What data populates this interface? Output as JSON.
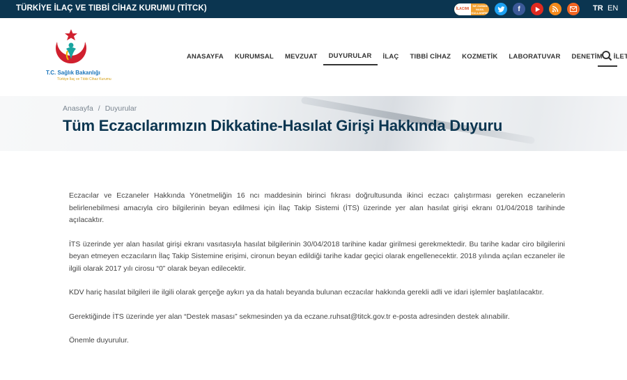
{
  "topbar": {
    "org_name": "TÜRKİYE İLAÇ VE TIBBİ CİHAZ KURUMU (TİTCK)",
    "badge": {
      "left": "İLACIMI",
      "right": "NE ZAMAN NASIL KULLANIRIM"
    },
    "social_icons": [
      "twitter-icon",
      "facebook-icon",
      "youtube-icon",
      "rss-icon",
      "mail-icon"
    ],
    "lang_tr": "TR",
    "lang_en": "EN"
  },
  "logo": {
    "line1": "T.C. Sağlık Bakanlığı",
    "line2": "Türkiye İlaç ve Tıbbi Cihaz Kurumu"
  },
  "nav": {
    "items": [
      "ANASAYFA",
      "KURUMSAL",
      "MEVZUAT",
      "DUYURULAR",
      "İLAÇ",
      "TIBBİ CİHAZ",
      "KOZMETİK",
      "LABORATUVAR",
      "DENETİM",
      "İLETİŞİM"
    ],
    "active": "DUYURULAR"
  },
  "breadcrumb": {
    "home": "Anasayfa",
    "separator": "/",
    "current": "Duyurular"
  },
  "page_title": "Tüm Eczacılarımızın Dikkatine-Hasılat Girişi Hakkında Duyuru",
  "content": {
    "paragraphs": [
      "Eczacılar ve Eczaneler Hakkında Yönetmeliğin 16 ncı maddesinin birinci fıkrası doğrultusunda ikinci eczacı çalıştırması gereken eczanelerin belirlenebilmesi amacıyla ciro bilgilerinin beyan edilmesi için İlaç Takip Sistemi (İTS) üzerinde yer alan hasılat girişi ekranı 01/04/2018 tarihinde açılacaktır.",
      "İTS üzerinde yer alan hasılat girişi ekranı vasıtasıyla hasılat bilgilerinin 30/04/2018 tarihine kadar girilmesi gerekmektedir. Bu tarihe kadar ciro bilgilerini beyan etmeyen eczacıların İlaç Takip Sistemine erişimi, cironun beyan edildiği tarihe kadar geçici olarak engellenecektir. 2018 yılında açılan eczaneler ile ilgili olarak 2017 yılı cirosu “0” olarak beyan edilecektir.",
      "KDV hariç hasılat bilgileri ile ilgili olarak gerçeğe aykırı ya da hatalı beyanda bulunan eczacılar hakkında gerekli adli ve idari işlemler başlatılacaktır.",
      "Gerektiğinde İTS üzerinde yer alan “Destek masası” sekmesinden ya da eczane.ruhsat@titck.gov.tr e-posta adresinden destek alınabilir.",
      "Önemle duyurulur."
    ]
  },
  "colors": {
    "topbar_bg": "#0b3550",
    "title": "#0b3550",
    "logo_red": "#d0202e",
    "logo_teal": "#1aa5a0"
  }
}
